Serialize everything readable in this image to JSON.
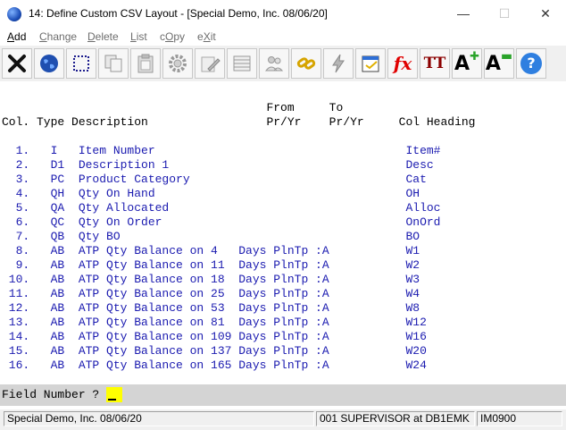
{
  "window": {
    "title": "14: Define Custom CSV Layout - [Special Demo, Inc. 08/06/20]",
    "minimize_glyph": "—",
    "maximize_glyph": "☐",
    "close_glyph": "✕"
  },
  "menu": {
    "add": {
      "accel": "A",
      "rest": "dd"
    },
    "change": {
      "accel": "C",
      "rest": "hange"
    },
    "delete": {
      "accel": "D",
      "rest": "elete"
    },
    "list": {
      "accel": "L",
      "rest": "ist"
    },
    "copy": {
      "pre": "c",
      "accel": "O",
      "rest": "py"
    },
    "exit": {
      "pre": "e",
      "accel": "X",
      "rest": "it"
    }
  },
  "toolbar": {
    "icons": [
      "close-x-icon",
      "globe-icon",
      "dotted-select-icon",
      "copy-pages-icon",
      "paste-clipboard-icon",
      "gear-icon",
      "edit-pencil-icon",
      "table-icon",
      "users-icon",
      "chain-link-icon",
      "lightning-icon",
      "calendar-icon",
      "fx-function-icon",
      "text-size-icon",
      "font-increase-icon",
      "font-decrease-icon",
      "help-icon"
    ],
    "fx_text": "fx",
    "tt_text": "TT",
    "a_text": "A",
    "help_text": "?"
  },
  "table": {
    "header_line1": "                                      From     To",
    "header_line2": "Col. Type Description                 Pr/Yr    Pr/Yr     Col Heading",
    "rows": [
      "  1.   I   Item Number                                    Item#",
      "  2.   D1  Description 1                                  Desc",
      "  3.   PC  Product Category                               Cat",
      "  4.   QH  Qty On Hand                                    OH",
      "  5.   QA  Qty Allocated                                  Alloc",
      "  6.   QC  Qty On Order                                   OnOrd",
      "  7.   QB  Qty BO                                         BO",
      "  8.   AB  ATP Qty Balance on 4   Days PlnTp :A           W1",
      "  9.   AB  ATP Qty Balance on 11  Days PlnTp :A           W2",
      " 10.   AB  ATP Qty Balance on 18  Days PlnTp :A           W3",
      " 11.   AB  ATP Qty Balance on 25  Days PlnTp :A           W4",
      " 12.   AB  ATP Qty Balance on 53  Days PlnTp :A           W8",
      " 13.   AB  ATP Qty Balance on 81  Days PlnTp :A           W12",
      " 14.   AB  ATP Qty Balance on 109 Days PlnTp :A           W16",
      " 15.   AB  ATP Qty Balance on 137 Days PlnTp :A           W20",
      " 16.   AB  ATP Qty Balance on 165 Days PlnTp :A           W24"
    ]
  },
  "prompt": {
    "label": "Field Number ?",
    "value": ""
  },
  "status": {
    "company": "Special Demo, Inc. 08/06/20",
    "user": "001 SUPERVISOR at DB1EMK",
    "program": "IM0900"
  },
  "colors": {
    "row_text": "#1b1bb0",
    "prompt_bg": "#d4d4d4",
    "input_bg": "#ffff00"
  }
}
